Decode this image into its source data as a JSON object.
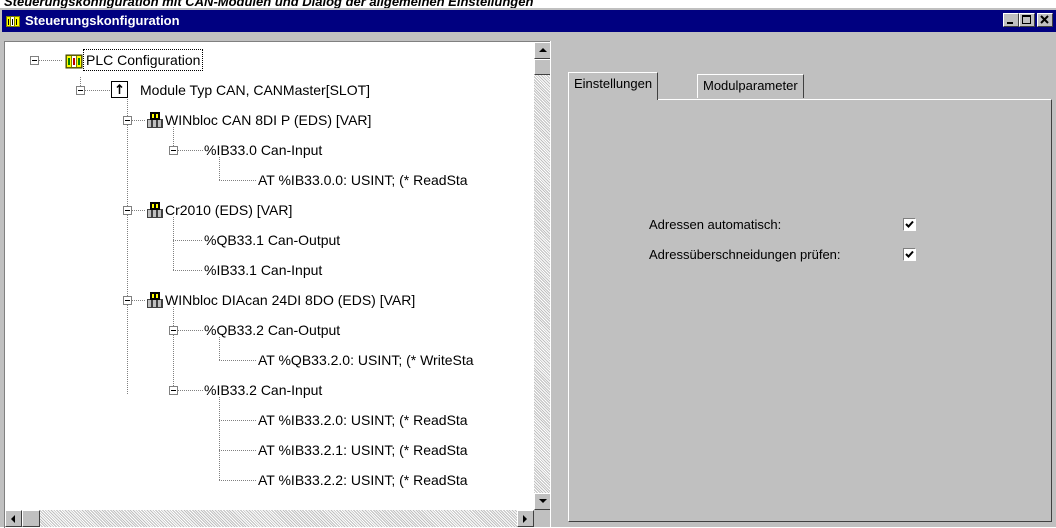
{
  "caption": "Steuerungskonfiguration mit CAN-Modulen und Dialog der allgemeinen Einstellungen",
  "window": {
    "title": "Steuerungskonfiguration",
    "icon": "plc-config-icon"
  },
  "tree": {
    "nodes": [
      {
        "label": "PLC Configuration",
        "icon": "plc-icon",
        "expander": true
      },
      {
        "label": "Module Typ CAN, CANMaster[SLOT]",
        "icon": "module-slot-icon",
        "expander": true
      },
      {
        "label": "WINbloc CAN 8DI P (EDS)  [VAR]",
        "icon": "can-module-icon",
        "expander": true
      },
      {
        "label": "%IB33.0 Can-Input",
        "icon": "",
        "expander": true
      },
      {
        "label": "AT %IB33.0.0: USINT; (* ReadSta",
        "icon": "",
        "expander": false
      },
      {
        "label": "Cr2010 (EDS)  [VAR]",
        "icon": "can-module-icon",
        "expander": true
      },
      {
        "label": "%QB33.1 Can-Output",
        "icon": "",
        "expander": false
      },
      {
        "label": "%IB33.1 Can-Input",
        "icon": "",
        "expander": false
      },
      {
        "label": "WINbloc DIAcan 24DI 8DO (EDS)  [VAR]",
        "icon": "can-module-icon",
        "expander": true
      },
      {
        "label": "%QB33.2 Can-Output",
        "icon": "",
        "expander": true
      },
      {
        "label": "AT %QB33.2.0: USINT; (* WriteSta",
        "icon": "",
        "expander": false
      },
      {
        "label": "%IB33.2 Can-Input",
        "icon": "",
        "expander": true
      },
      {
        "label": "AT %IB33.2.0: USINT; (* ReadSta",
        "icon": "",
        "expander": false
      },
      {
        "label": "AT %IB33.2.1: USINT; (* ReadSta",
        "icon": "",
        "expander": false
      },
      {
        "label": "AT %IB33.2.2: USINT; (* ReadSta",
        "icon": "",
        "expander": false
      }
    ]
  },
  "tabs": [
    {
      "label": "Einstellungen",
      "active": true
    },
    {
      "label": "Modulparameter",
      "active": false
    }
  ],
  "settings": {
    "auto_address_label": "Adressen automatisch:",
    "auto_address_checked": true,
    "overlap_check_label": "Adressüberschneidungen prüfen:",
    "overlap_check_checked": true
  },
  "colors": {
    "titlebar": "#000080",
    "face": "#c0c0c0"
  }
}
